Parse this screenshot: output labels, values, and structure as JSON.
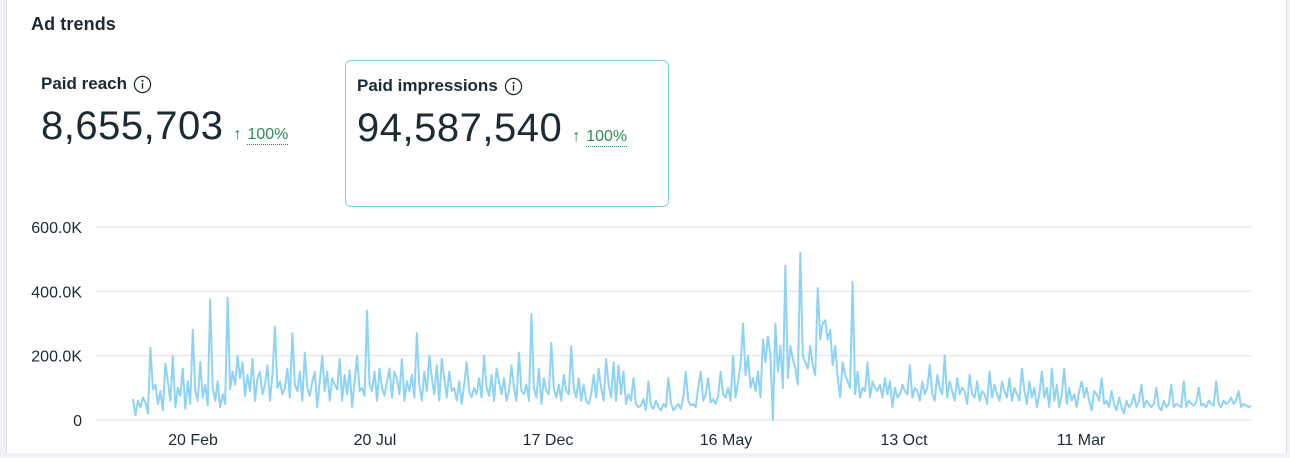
{
  "header": {
    "title": "Ad trends"
  },
  "metrics": [
    {
      "label": "Paid reach",
      "value": "8,655,703",
      "change": "100%",
      "direction": "up",
      "selected": false
    },
    {
      "label": "Paid impressions",
      "value": "94,587,540",
      "change": "100%",
      "direction": "up",
      "selected": true
    }
  ],
  "icons": {
    "info": "info-circle-icon",
    "trend": "arrow-up-icon"
  },
  "colors": {
    "line": "#8fd3f4",
    "selected_border": "#7ad1db",
    "trend_up": "#2e8b57",
    "grid": "#e4e6eb"
  },
  "chart_data": {
    "type": "line",
    "y_tick_labels": [
      "0",
      "200.0K",
      "400.0K",
      "600.0K"
    ],
    "y_ticks": [
      0,
      200000,
      400000,
      600000
    ],
    "ylim": [
      0,
      600000
    ],
    "x_tick_labels": [
      "20 Feb",
      "20 Jul",
      "17 Dec",
      "16 May",
      "13 Oct",
      "11 Mar"
    ],
    "grid": true,
    "series": [
      {
        "values": [
          65000,
          15000,
          60000,
          40000,
          70000,
          55000,
          20000,
          225000,
          95000,
          110000,
          50000,
          90000,
          30000,
          175000,
          120000,
          60000,
          200000,
          40000,
          100000,
          75000,
          160000,
          35000,
          120000,
          50000,
          280000,
          90000,
          60000,
          180000,
          70000,
          110000,
          45000,
          375000,
          100000,
          60000,
          120000,
          40000,
          80000,
          50000,
          380000,
          95000,
          150000,
          110000,
          200000,
          130000,
          180000,
          75000,
          140000,
          90000,
          190000,
          60000,
          130000,
          150000,
          80000,
          110000,
          170000,
          60000,
          140000,
          290000,
          100000,
          120000,
          80000,
          100000,
          160000,
          70000,
          270000,
          110000,
          90000,
          150000,
          60000,
          210000,
          100000,
          75000,
          120000,
          150000,
          40000,
          120000,
          200000,
          90000,
          150000,
          60000,
          130000,
          110000,
          95000,
          190000,
          60000,
          140000,
          80000,
          155000,
          40000,
          120000,
          200000,
          90000,
          100000,
          75000,
          340000,
          110000,
          90000,
          150000,
          60000,
          160000,
          100000,
          75000,
          120000,
          160000,
          70000,
          150000,
          130000,
          80000,
          190000,
          60000,
          120000,
          90000,
          140000,
          70000,
          270000,
          110000,
          60000,
          150000,
          90000,
          200000,
          130000,
          80000,
          170000,
          60000,
          190000,
          130000,
          70000,
          150000,
          90000,
          100000,
          60000,
          120000,
          50000,
          110000,
          180000,
          90000,
          70000,
          100000,
          80000,
          130000,
          70000,
          200000,
          100000,
          75000,
          140000,
          60000,
          160000,
          120000,
          80000,
          130000,
          60000,
          90000,
          170000,
          100000,
          60000,
          210000,
          90000,
          80000,
          110000,
          60000,
          330000,
          100000,
          70000,
          160000,
          50000,
          130000,
          90000,
          80000,
          240000,
          100000,
          70000,
          110000,
          60000,
          140000,
          90000,
          80000,
          230000,
          100000,
          70000,
          130000,
          60000,
          110000,
          60000,
          50000,
          80000,
          140000,
          70000,
          160000,
          100000,
          60000,
          190000,
          110000,
          70000,
          180000,
          60000,
          170000,
          80000,
          150000,
          50000,
          80000,
          60000,
          130000,
          50000,
          40000,
          45000,
          65000,
          30000,
          120000,
          45000,
          35000,
          60000,
          40000,
          30000,
          50000,
          40000,
          130000,
          55000,
          30000,
          40000,
          50000,
          35000,
          70000,
          150000,
          60000,
          45000,
          50000,
          40000,
          100000,
          150000,
          60000,
          80000,
          130000,
          55000,
          65000,
          50000,
          75000,
          150000,
          80000,
          70000,
          100000,
          60000,
          200000,
          70000,
          120000,
          170000,
          300000,
          140000,
          200000,
          100000,
          130000,
          90000,
          150000,
          70000,
          250000,
          180000,
          260000,
          200000,
          0,
          300000,
          150000,
          230000,
          100000,
          480000,
          130000,
          230000,
          190000,
          160000,
          110000,
          520000,
          200000,
          180000,
          160000,
          230000,
          170000,
          140000,
          410000,
          250000,
          300000,
          310000,
          250000,
          280000,
          170000,
          230000,
          130000,
          70000,
          180000,
          140000,
          120000,
          100000,
          430000,
          80000,
          150000,
          70000,
          100000,
          90000,
          180000,
          70000,
          120000,
          100000,
          90000,
          110000,
          70000,
          130000,
          80000,
          120000,
          40000,
          100000,
          70000,
          80000,
          110000,
          90000,
          80000,
          170000,
          70000,
          100000,
          90000,
          60000,
          120000,
          80000,
          100000,
          170000,
          80000,
          60000,
          140000,
          100000,
          80000,
          200000,
          70000,
          120000,
          90000,
          60000,
          130000,
          80000,
          100000,
          90000,
          50000,
          140000,
          80000,
          70000,
          120000,
          60000,
          90000,
          80000,
          50000,
          150000,
          70000,
          110000,
          80000,
          60000,
          120000,
          90000,
          70000,
          130000,
          60000,
          100000,
          80000,
          60000,
          160000,
          90000,
          50000,
          120000,
          70000,
          100000,
          40000,
          80000,
          150000,
          70000,
          100000,
          40000,
          160000,
          60000,
          110000,
          40000,
          80000,
          160000,
          50000,
          100000,
          60000,
          80000,
          40000,
          90000,
          120000,
          70000,
          100000,
          60000,
          30000,
          90000,
          80000,
          60000,
          130000,
          50000,
          60000,
          40000,
          90000,
          50000,
          30000,
          70000,
          40000,
          20000,
          60000,
          40000,
          50000,
          80000,
          40000,
          60000,
          110000,
          40000,
          60000,
          50000,
          40000,
          50000,
          100000,
          40000,
          30000,
          60000,
          40000,
          50000,
          110000,
          40000,
          50000,
          45000,
          40000,
          120000,
          40000,
          60000,
          50000,
          45000,
          55000,
          100000,
          45000,
          50000,
          40000,
          60000,
          50000,
          45000,
          120000,
          50000,
          40000,
          60000,
          50000,
          55000,
          70000,
          50000,
          60000,
          90000,
          40000,
          50000,
          45000,
          40000,
          45000
        ]
      }
    ]
  }
}
